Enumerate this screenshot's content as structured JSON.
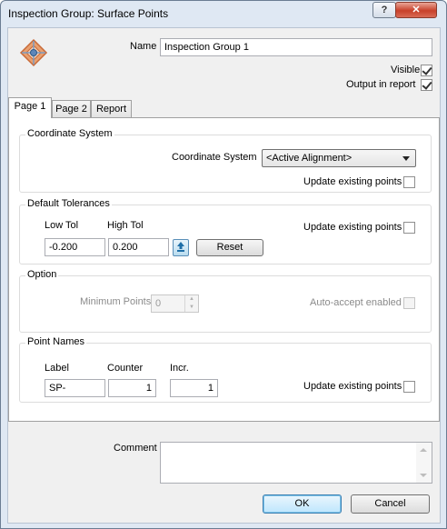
{
  "window": {
    "title": "Inspection Group: Surface Points",
    "help_label": "?",
    "close_label": "✕"
  },
  "header": {
    "name_label": "Name",
    "name_value": "Inspection Group 1",
    "visible_label": "Visible",
    "visible_checked": true,
    "output_label": "Output in report",
    "output_checked": true,
    "logo_icon": "inspection-group-logo"
  },
  "tabs": [
    {
      "label": "Page 1"
    },
    {
      "label": "Page 2"
    },
    {
      "label": "Report"
    }
  ],
  "coordinate_system": {
    "title": "Coordinate System",
    "label": "Coordinate System",
    "selected": "<Active Alignment>",
    "update_label": "Update existing points",
    "update_checked": false
  },
  "default_tolerances": {
    "title": "Default Tolerances",
    "low_label": "Low Tol",
    "high_label": "High Tol",
    "low_value": "-0.200",
    "high_value": "0.200",
    "swap_icon": "up-down-arrow-icon",
    "reset_label": "Reset",
    "update_label": "Update existing points",
    "update_checked": false
  },
  "option": {
    "title": "Option",
    "min_points_label": "Minimum Points",
    "min_points_value": "0",
    "auto_accept_label": "Auto-accept enabled",
    "auto_accept_checked": false
  },
  "point_names": {
    "title": "Point Names",
    "label_header": "Label",
    "counter_header": "Counter",
    "incr_header": "Incr.",
    "label_value": "SP-",
    "counter_value": "1",
    "incr_value": "1",
    "update_label": "Update existing points",
    "update_checked": false
  },
  "comment": {
    "label": "Comment",
    "value": ""
  },
  "footer": {
    "ok_label": "OK",
    "cancel_label": "Cancel"
  },
  "colors": {
    "accent": "#3c7fb1",
    "frame": "#dfe8f3",
    "close": "#c8402a"
  }
}
